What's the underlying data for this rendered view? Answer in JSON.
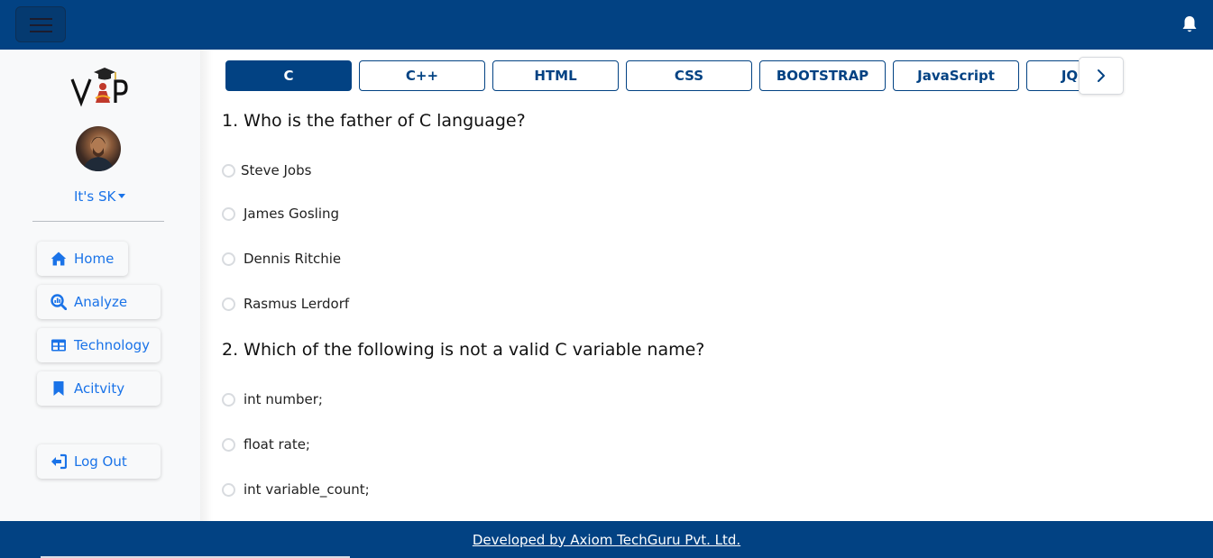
{
  "header": {
    "menu_icon": "hamburger-icon",
    "notification_icon": "bell-icon"
  },
  "sidebar": {
    "logo_text": "VIP",
    "user": {
      "name": "It's SK"
    },
    "nav": [
      {
        "label": "Home",
        "icon": "home-icon"
      },
      {
        "label": "Analyze",
        "icon": "analyze-icon"
      },
      {
        "label": "Technology",
        "icon": "table-icon"
      },
      {
        "label": "Acitvity",
        "icon": "bookmark-icon"
      }
    ],
    "logout": {
      "label": "Log Out",
      "icon": "logout-icon"
    }
  },
  "tabs": {
    "items": [
      "C",
      "C++",
      "HTML",
      "CSS",
      "BOOTSTRAP",
      "JavaScript",
      "JQUERY"
    ],
    "active": "C",
    "next_icon": "chevron-right-icon"
  },
  "quiz": {
    "questions": [
      {
        "text": "1. Who is the father of C language?",
        "options": [
          "Steve Jobs",
          "James Gosling",
          "Dennis Ritchie",
          "Rasmus Lerdorf"
        ]
      },
      {
        "text": "2. Which of the following is not a valid C variable name?",
        "options": [
          "int number;",
          "float rate;",
          "int variable_count;"
        ]
      }
    ]
  },
  "footer": {
    "credit": "Developed by Axiom TechGuru Pvt. Ltd."
  },
  "colors": {
    "primary": "#024283",
    "link": "#1a73e8",
    "sidebar_bg": "#f8f9fa"
  }
}
